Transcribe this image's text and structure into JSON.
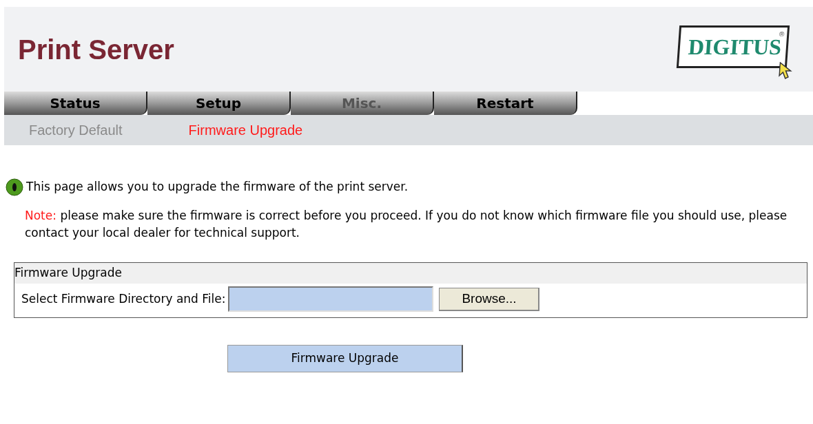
{
  "header": {
    "title": "Print Server",
    "logo": "DIGITUS",
    "logo_mark": "®"
  },
  "tabs": [
    {
      "label": "Status",
      "selected": false
    },
    {
      "label": "Setup",
      "selected": false
    },
    {
      "label": "Misc.",
      "selected": true
    },
    {
      "label": "Restart",
      "selected": false
    }
  ],
  "subnav": [
    {
      "label": "Factory Default",
      "selected": false
    },
    {
      "label": "Firmware Upgrade",
      "selected": true
    }
  ],
  "intro": "This page allows you to upgrade the firmware of the print server.",
  "note": {
    "label": "Note:",
    "text": "please make sure the firmware is correct before you proceed. If you do not know which firmware file you should use, please contact your local dealer for technical support."
  },
  "form": {
    "title": "Firmware Upgrade",
    "field_label": "Select Firmware Directory and File:",
    "browse": "Browse..."
  },
  "submit": "Firmware Upgrade"
}
